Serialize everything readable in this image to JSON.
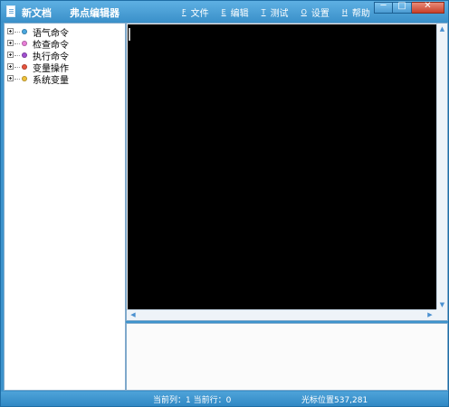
{
  "window": {
    "doc_title": "新文档",
    "app_title": "弗点编辑器"
  },
  "menu": [
    {
      "key": "F",
      "label": "文件"
    },
    {
      "key": "E",
      "label": "编辑"
    },
    {
      "key": "T",
      "label": "测试"
    },
    {
      "key": "O",
      "label": "设置"
    },
    {
      "key": "H",
      "label": "帮助"
    }
  ],
  "window_controls": {
    "minimize": "─",
    "maximize": "□",
    "close": "✕"
  },
  "tree": {
    "items": [
      {
        "label": "语气命令",
        "color": "#4aa8e0"
      },
      {
        "label": "检查命令",
        "color": "#e97fd9"
      },
      {
        "label": "执行命令",
        "color": "#a24fd1"
      },
      {
        "label": "变量操作",
        "color": "#e8543e"
      },
      {
        "label": "系统变量",
        "color": "#f0c23a"
      }
    ]
  },
  "scroll_arrows": {
    "up": "▲",
    "down": "▼",
    "left": "◀",
    "right": "▶"
  },
  "status": {
    "position": "当前列：1 当前行：0",
    "cursor": "光标位置537,281"
  },
  "colors": {
    "frame": "#3d93cc",
    "editor_bg": "#000000",
    "panel_bg": "#ffffff"
  }
}
